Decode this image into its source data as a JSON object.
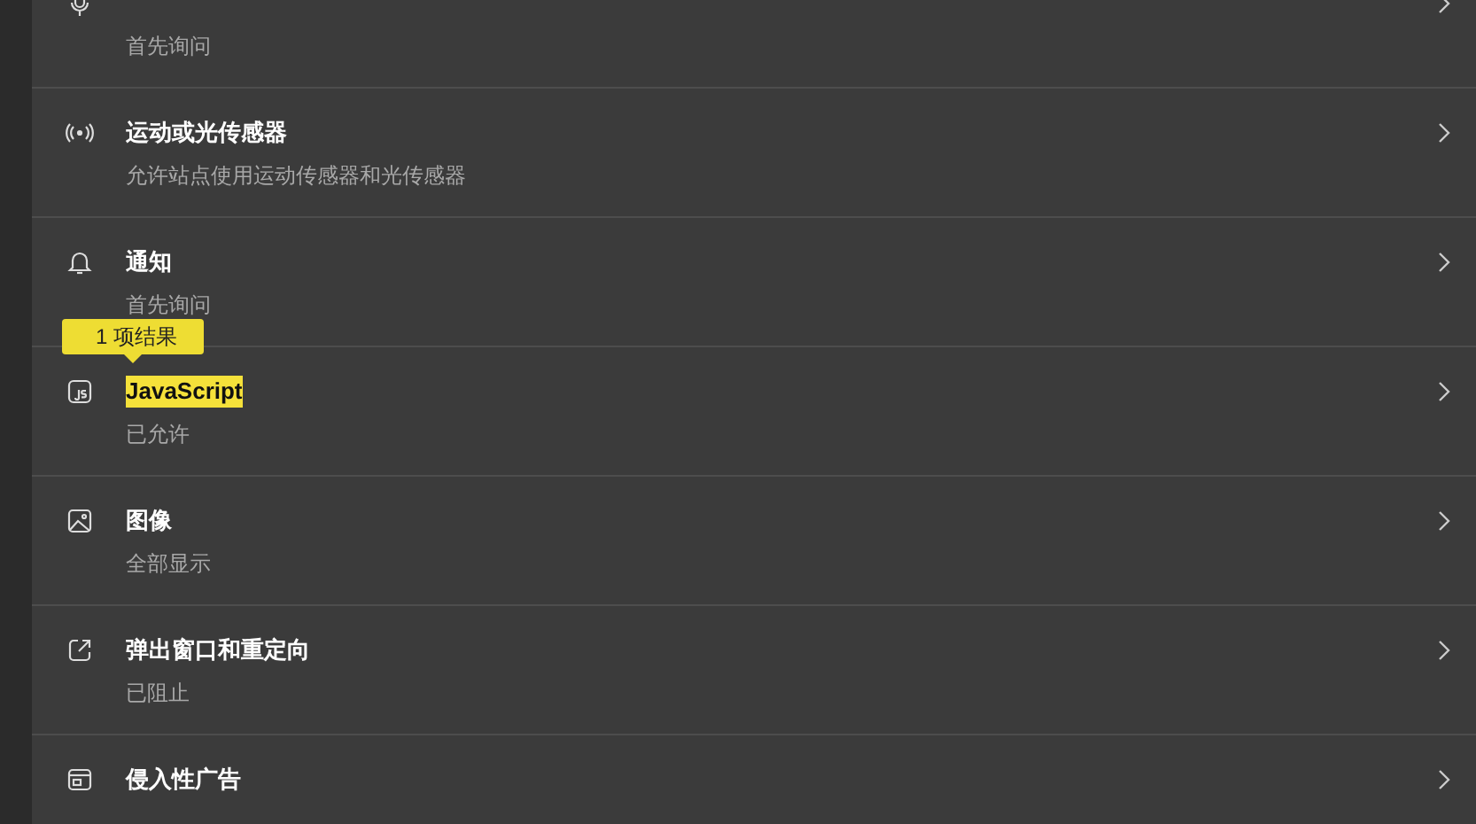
{
  "settings": [
    {
      "kind": "microphone",
      "subtitle": "首先询问"
    },
    {
      "kind": "sensor",
      "title": "运动或光传感器",
      "subtitle": "允许站点使用运动传感器和光传感器",
      "highlighted": false
    },
    {
      "kind": "bell",
      "title": "通知",
      "subtitle": "首先询问",
      "highlighted": false
    },
    {
      "kind": "javascript",
      "title": "JavaScript",
      "subtitle": "已允许",
      "highlighted": true,
      "search_tooltip": "1 项结果"
    },
    {
      "kind": "image",
      "title": "图像",
      "subtitle": "全部显示",
      "highlighted": false
    },
    {
      "kind": "popup",
      "title": "弹出窗口和重定向",
      "subtitle": "已阻止",
      "highlighted": false
    },
    {
      "kind": "ad",
      "title": "侵入性广告",
      "highlighted": false
    }
  ]
}
